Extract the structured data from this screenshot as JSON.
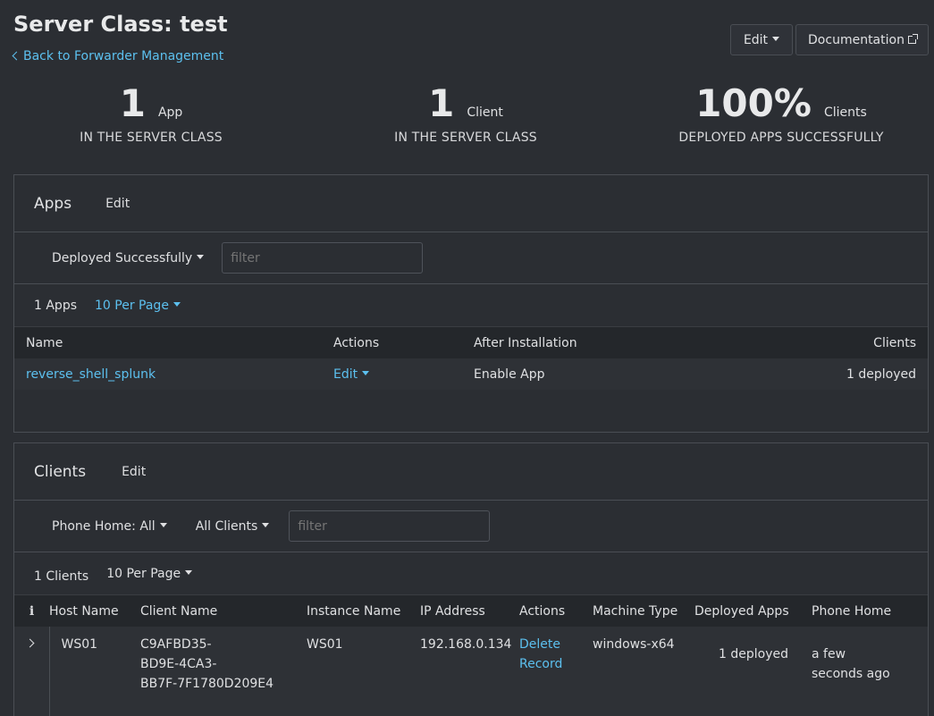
{
  "header": {
    "title": "Server Class: test",
    "back_link": "Back to Forwarder Management",
    "edit_label": "Edit",
    "doc_label": "Documentation"
  },
  "stats": [
    {
      "value": "1",
      "unit": "App",
      "caption": "IN THE SERVER CLASS"
    },
    {
      "value": "1",
      "unit": "Client",
      "caption": "IN THE SERVER CLASS"
    },
    {
      "value": "100%",
      "unit": "Clients",
      "caption": "DEPLOYED APPS SUCCESSFULLY"
    }
  ],
  "apps": {
    "title": "Apps",
    "edit_label": "Edit",
    "status_filter": "Deployed Successfully",
    "filter_placeholder": "filter",
    "count": "1 Apps",
    "per_page": "10 Per Page",
    "columns": [
      "Name",
      "Actions",
      "After Installation",
      "Clients"
    ],
    "rows": [
      {
        "name": "reverse_shell_splunk",
        "action": "Edit",
        "after_install": "Enable App",
        "clients": "1 deployed"
      }
    ]
  },
  "clients": {
    "title": "Clients",
    "edit_label": "Edit",
    "phone_home_filter": "Phone Home: All",
    "clients_filter": "All Clients",
    "filter_placeholder": "filter",
    "count": "1 Clients",
    "per_page": "10 Per Page",
    "info_icon_glyph": "i",
    "columns": [
      "Host Name",
      "Client Name",
      "Instance Name",
      "IP Address",
      "Actions",
      "Machine Type",
      "Deployed Apps",
      "Phone Home"
    ],
    "rows": [
      {
        "host": "WS01",
        "client_name_lines": [
          "C9AFBD35-",
          "BD9E-4CA3-",
          "BB7F-7F1780D209E4"
        ],
        "instance": "WS01",
        "ip": "192.168.0.134",
        "action_lines": [
          "Delete",
          "Record"
        ],
        "machine": "windows-x64",
        "deployed": "1 deployed",
        "phone_home_lines": [
          "a few",
          "seconds ago"
        ]
      }
    ]
  },
  "colors": {
    "background": "#2b2e33",
    "link": "#5cc0ef",
    "table_header": "#24272b",
    "border": "#4a4e54"
  }
}
